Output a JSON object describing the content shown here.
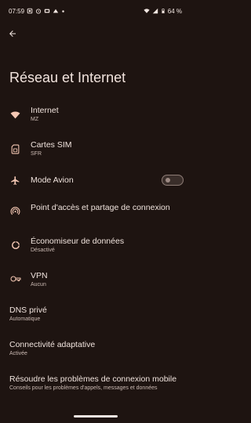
{
  "status_bar": {
    "time": "07:59",
    "battery": "64 %",
    "left_icons": [
      "notification-icon",
      "alarm-icon",
      "sim-icon",
      "cloud-icon",
      "dot-icon"
    ],
    "right_icons": [
      "wifi-icon",
      "signal-icon",
      "battery-icon"
    ]
  },
  "header": {
    "title": "Réseau et Internet"
  },
  "items": [
    {
      "title": "Internet",
      "subtitle": "MZ",
      "icon": "wifi-icon"
    },
    {
      "title": "Cartes SIM",
      "subtitle": "SFR",
      "icon": "sim-card-icon"
    },
    {
      "title": "Mode Avion",
      "subtitle": "",
      "icon": "airplane-icon",
      "toggle": false
    },
    {
      "title": "Point d'accès et partage de connexion",
      "subtitle": "",
      "icon": "hotspot-icon"
    },
    {
      "title": "Économiseur de données",
      "subtitle": "Désactivé",
      "icon": "data-saver-icon"
    },
    {
      "title": "VPN",
      "subtitle": "Aucun",
      "icon": "vpn-key-icon"
    },
    {
      "title": "DNS privé",
      "subtitle": "Automatique"
    },
    {
      "title": "Connectivité adaptative",
      "subtitle": "Activée"
    },
    {
      "title": "Résoudre les problèmes de connexion mobile",
      "subtitle": "Conseils pour les problèmes d'appels, messages et données"
    }
  ],
  "colors": {
    "background": "#1e1411",
    "icon": "#f4c7b3",
    "text": "#f1e4de",
    "subtext": "#cbbab3"
  }
}
